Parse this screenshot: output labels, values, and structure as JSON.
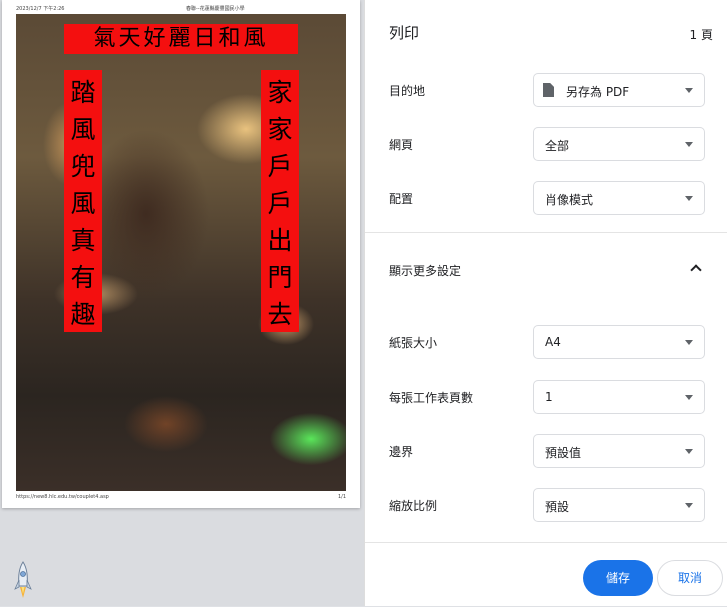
{
  "preview": {
    "print_date": "2023/12/7 下午2:26",
    "print_title": "春聯--花蓮縣慶豐國民小學",
    "print_url": "https://new8.hlc.edu.tw/couplet4.asp",
    "page_number": "1/1",
    "couplet": {
      "top": "氣天好麗日和風",
      "left": "踏風兜風真有趣",
      "right": "家家戶戶出門去"
    }
  },
  "settings": {
    "title": "列印",
    "sheet_count": "1 頁",
    "destination": {
      "label": "目的地",
      "value": "另存為 PDF",
      "icon": "file-icon"
    },
    "pages": {
      "label": "網頁",
      "value": "全部"
    },
    "layout": {
      "label": "配置",
      "value": "肖像模式"
    },
    "more_settings": {
      "label": "顯示更多設定",
      "icon": "chevron-up-icon"
    },
    "paper_size": {
      "label": "紙張大小",
      "value": "A4"
    },
    "pages_per_sheet": {
      "label": "每張工作表頁數",
      "value": "1"
    },
    "margins": {
      "label": "邊界",
      "value": "預設值"
    },
    "scale": {
      "label": "縮放比例",
      "value": "預設"
    }
  },
  "footer": {
    "save_label": "儲存",
    "cancel_label": "取消"
  },
  "colors": {
    "accent": "#1a73e8",
    "banner": "#f40f0f"
  }
}
